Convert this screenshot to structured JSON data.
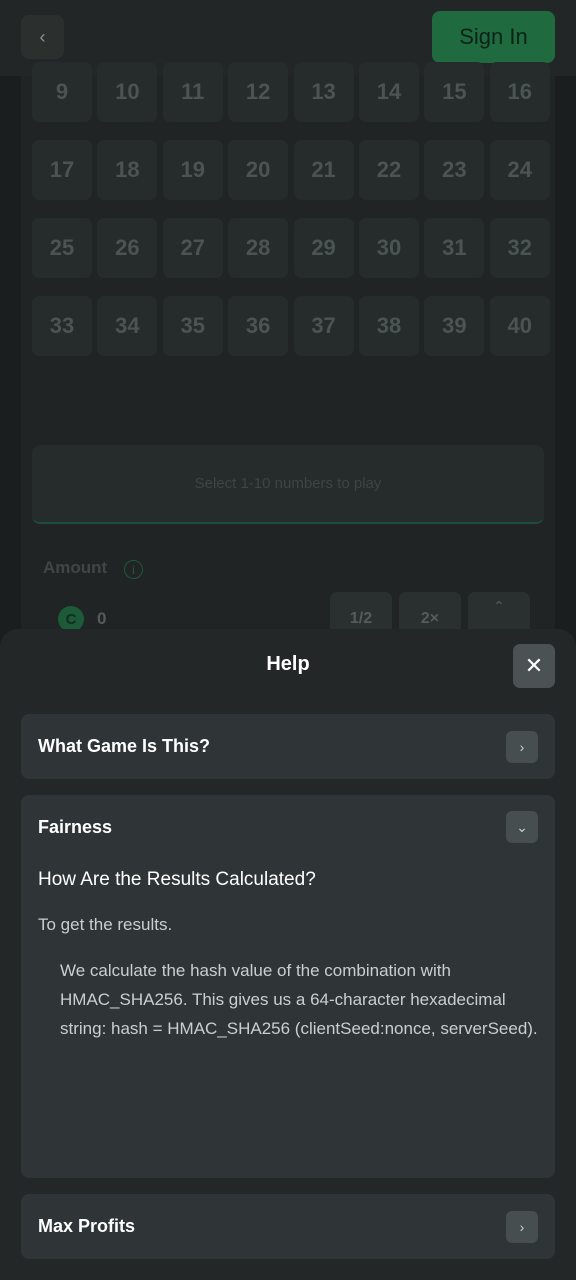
{
  "header": {
    "back_icon": "chevron-left-icon",
    "sign_in_label": "Sign In"
  },
  "board": {
    "numbers": [
      "9",
      "10",
      "11",
      "12",
      "13",
      "14",
      "15",
      "16",
      "17",
      "18",
      "19",
      "20",
      "21",
      "22",
      "23",
      "24",
      "25",
      "26",
      "27",
      "28",
      "29",
      "30",
      "31",
      "32",
      "33",
      "34",
      "35",
      "36",
      "37",
      "38",
      "39",
      "40"
    ],
    "hint": "Select 1-10 numbers to play"
  },
  "bet": {
    "amount_label": "Amount",
    "amount_value": "0",
    "half_label": "1/2",
    "double_label": "2×"
  },
  "help": {
    "title": "Help",
    "close_icon": "close-icon",
    "sections": [
      {
        "title": "What Game Is This?",
        "expanded": false
      },
      {
        "title": "Fairness",
        "expanded": true,
        "subtitle": "How Are the Results Calculated?",
        "intro": "To get the results.",
        "detail": "We calculate the hash value of the combination with HMAC_SHA256. This gives us a 64-character hexadecimal string: hash = HMAC_SHA256 (clientSeed:nonce, serverSeed)."
      },
      {
        "title": "Max Profits",
        "expanded": false
      }
    ]
  },
  "colors": {
    "accent_green": "#1f6a3e",
    "sheet_bg": "#232727",
    "card_bg": "#2f3536"
  }
}
